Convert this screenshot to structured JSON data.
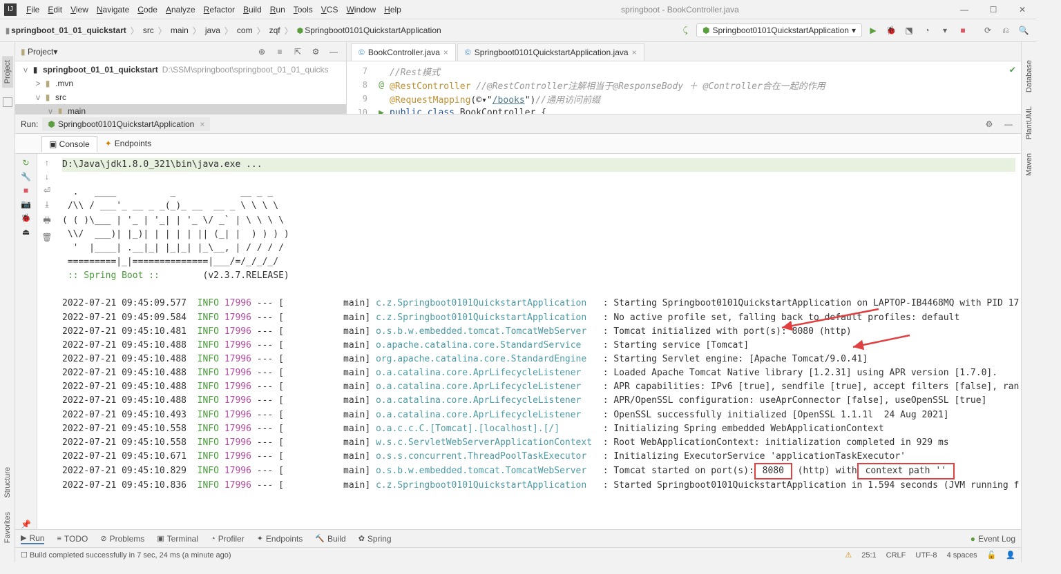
{
  "window": {
    "title": "springboot - BookController.java"
  },
  "menu": [
    "File",
    "Edit",
    "View",
    "Navigate",
    "Code",
    "Analyze",
    "Refactor",
    "Build",
    "Run",
    "Tools",
    "VCS",
    "Window",
    "Help"
  ],
  "breadcrumb": [
    "springboot_01_01_quickstart",
    "src",
    "main",
    "java",
    "com",
    "zqf",
    "Springboot0101QuickstartApplication"
  ],
  "runConfig": "Springboot0101QuickstartApplication",
  "projectPanel": {
    "title": "Project",
    "root": {
      "name": "springboot_01_01_quickstart",
      "path": "D:\\SSM\\springboot\\springboot_01_01_quicks"
    },
    "children": [
      {
        "indent": 1,
        "arrow": ">",
        "name": ".mvn"
      },
      {
        "indent": 1,
        "arrow": "v",
        "name": "src"
      },
      {
        "indent": 2,
        "arrow": "v",
        "name": "main",
        "selected": true
      }
    ]
  },
  "leftTabs": [
    "Project"
  ],
  "leftIcons": [
    "Structure",
    "Favorites"
  ],
  "rightTabs": [
    "Database",
    "PlantUML",
    "Maven"
  ],
  "editorTabs": [
    {
      "label": "BookController.java",
      "active": true
    },
    {
      "label": "Springboot0101QuickstartApplication.java",
      "active": false
    }
  ],
  "code": {
    "lines": [
      {
        "num": 7,
        "html": "<span class='cl-gray'>//Rest模式</span>"
      },
      {
        "num": 8,
        "icon": "@",
        "html": "<span class='cl-orange'>@RestController</span>    <span class='cl-gray'>//@RestController注解相当于@ResponseBody ＋ @Controller合在一起的作用</span>"
      },
      {
        "num": 9,
        "html": "<span class='cl-orange'>@RequestMapping</span>(<span>©</span>&#x25BE;\"<span class='cl-link'>/books</span>\")<span class='cl-gray'>//通用访问前缀</span>"
      },
      {
        "num": 10,
        "icon": "▶",
        "html": "<span class='cl-key'>public class</span> BookController {"
      }
    ]
  },
  "runTab": {
    "label": "Springboot0101QuickstartApplication"
  },
  "subtabs": [
    {
      "label": "Console",
      "active": true
    },
    {
      "label": "Endpoints",
      "active": false
    }
  ],
  "cmd": "D:\\Java\\jdk1.8.0_321\\bin\\java.exe ...",
  "ascii": [
    "  .   ____          _            __ _ _",
    " /\\\\ / ___'_ __ _ _(_)_ __  __ _ \\ \\ \\ \\",
    "( ( )\\___ | '_ | '_| | '_ \\/ _` | \\ \\ \\ \\",
    " \\\\/  ___)| |_)| | | | | || (_| |  ) ) ) )",
    "  '  |____| .__|_| |_|_| |_\\__, | / / / /",
    " =========|_|==============|___/=/_/_/_/"
  ],
  "springLine": {
    "label": " :: Spring Boot ::        ",
    "version": "(v2.3.7.RELEASE)"
  },
  "log": [
    {
      "ts": "2022-07-21 09:45:09.577",
      "lv": "INFO",
      "pid": "17996",
      "th": "main",
      "lg": "c.z.Springboot0101QuickstartApplication  ",
      "msg": "Starting Springboot0101QuickstartApplication on LAPTOP-IB4468MQ with PID 17"
    },
    {
      "ts": "2022-07-21 09:45:09.584",
      "lv": "INFO",
      "pid": "17996",
      "th": "main",
      "lg": "c.z.Springboot0101QuickstartApplication  ",
      "msg": "No active profile set, falling back to default profiles: default"
    },
    {
      "ts": "2022-07-21 09:45:10.481",
      "lv": "INFO",
      "pid": "17996",
      "th": "main",
      "lg": "o.s.b.w.embedded.tomcat.TomcatWebServer  ",
      "msg": "Tomcat initialized with port(s): 8080 (http)",
      "arrow1": true
    },
    {
      "ts": "2022-07-21 09:45:10.488",
      "lv": "INFO",
      "pid": "17996",
      "th": "main",
      "lg": "o.apache.catalina.core.StandardService   ",
      "msg": "Starting service [Tomcat]"
    },
    {
      "ts": "2022-07-21 09:45:10.488",
      "lv": "INFO",
      "pid": "17996",
      "th": "main",
      "lg": "org.apache.catalina.core.StandardEngine  ",
      "msg": "Starting Servlet engine: [Apache Tomcat/9.0.41]",
      "arrow2": true
    },
    {
      "ts": "2022-07-21 09:45:10.488",
      "lv": "INFO",
      "pid": "17996",
      "th": "main",
      "lg": "o.a.catalina.core.AprLifecycleListener   ",
      "msg": "Loaded Apache Tomcat Native library [1.2.31] using APR version [1.7.0]."
    },
    {
      "ts": "2022-07-21 09:45:10.488",
      "lv": "INFO",
      "pid": "17996",
      "th": "main",
      "lg": "o.a.catalina.core.AprLifecycleListener   ",
      "msg": "APR capabilities: IPv6 [true], sendfile [true], accept filters [false], ran"
    },
    {
      "ts": "2022-07-21 09:45:10.488",
      "lv": "INFO",
      "pid": "17996",
      "th": "main",
      "lg": "o.a.catalina.core.AprLifecycleListener   ",
      "msg": "APR/OpenSSL configuration: useAprConnector [false], useOpenSSL [true]"
    },
    {
      "ts": "2022-07-21 09:45:10.493",
      "lv": "INFO",
      "pid": "17996",
      "th": "main",
      "lg": "o.a.catalina.core.AprLifecycleListener   ",
      "msg": "OpenSSL successfully initialized [OpenSSL 1.1.1l  24 Aug 2021]"
    },
    {
      "ts": "2022-07-21 09:45:10.558",
      "lv": "INFO",
      "pid": "17996",
      "th": "main",
      "lg": "o.a.c.c.C.[Tomcat].[localhost].[/]       ",
      "msg": "Initializing Spring embedded WebApplicationContext"
    },
    {
      "ts": "2022-07-21 09:45:10.558",
      "lv": "INFO",
      "pid": "17996",
      "th": "main",
      "lg": "w.s.c.ServletWebServerApplicationContext ",
      "msg": "Root WebApplicationContext: initialization completed in 929 ms"
    },
    {
      "ts": "2022-07-21 09:45:10.671",
      "lv": "INFO",
      "pid": "17996",
      "th": "main",
      "lg": "o.s.s.concurrent.ThreadPoolTaskExecutor  ",
      "msg": "Initializing ExecutorService 'applicationTaskExecutor'"
    },
    {
      "ts": "2022-07-21 09:45:10.829",
      "lv": "INFO",
      "pid": "17996",
      "th": "main",
      "lg": "o.s.b.w.embedded.tomcat.TomcatWebServer  ",
      "msg": "Tomcat started on port(s):",
      "box1": " 8080 ",
      "mid": "(http) with",
      "box2": " context path '' "
    },
    {
      "ts": "2022-07-21 09:45:10.836",
      "lv": "INFO",
      "pid": "17996",
      "th": "main",
      "lg": "c.z.Springboot0101QuickstartApplication  ",
      "msg": "Started Springboot0101QuickstartApplication in 1.594 seconds (JVM running f"
    }
  ],
  "bottomTabs": [
    "Run",
    "TODO",
    "Problems",
    "Terminal",
    "Profiler",
    "Endpoints",
    "Build",
    "Spring"
  ],
  "eventLog": "Event Log",
  "status": {
    "msg": "Build completed successfully in 7 sec, 24 ms (a minute ago)",
    "pos": "25:1",
    "eol": "CRLF",
    "enc": "UTF-8",
    "indent": "4 spaces"
  }
}
